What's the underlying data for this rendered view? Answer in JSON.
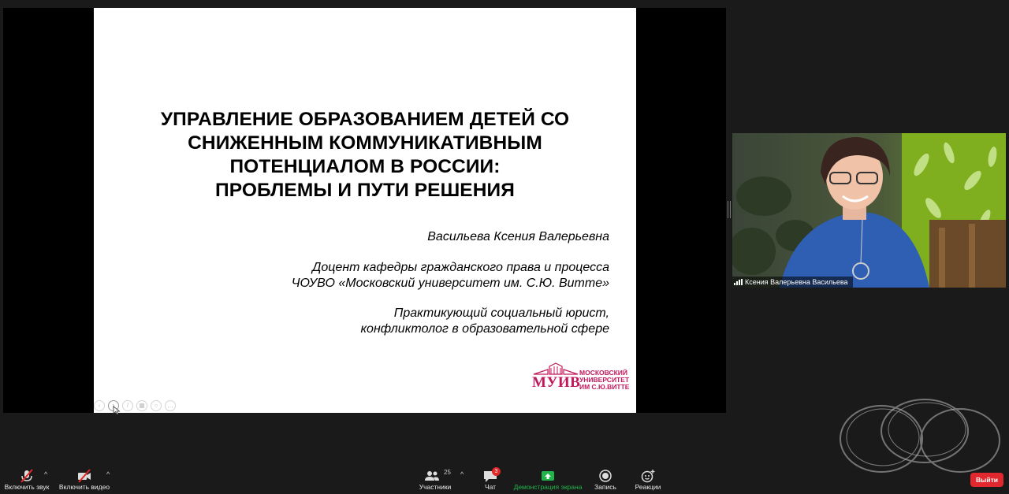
{
  "slide": {
    "title_lines": [
      "УПРАВЛЕНИЕ ОБРАЗОВАНИЕМ ДЕТЕЙ СО",
      "СНИЖЕННЫМ КОММУНИКАТИВНЫМ",
      "ПОТЕНЦИАЛОМ В РОССИИ:",
      "ПРОБЛЕМЫ И ПУТИ РЕШЕНИЯ"
    ],
    "author": "Васильева Ксения Валерьевна",
    "position_lines": [
      "Доцент кафедры гражданского права и процесса",
      "ЧОУВО «Московский университет им. С.Ю. Витте»"
    ],
    "practice_lines": [
      "Практикующий социальный юрист,",
      "конфликтолог в образовательной сфере"
    ],
    "logo": {
      "abbr": "МУИВ",
      "lines": [
        "МОСКОВСКИЙ",
        "УНИВЕРСИТЕТ",
        "ИМ С.Ю.ВИТТЕ"
      ],
      "color": "#c2185b"
    },
    "controls": [
      "arrow-left-icon",
      "arrow-right-icon",
      "pen-icon",
      "grid-icon",
      "zoom-icon",
      "more-icon"
    ]
  },
  "video": {
    "participant_name": "Ксения Валерьевна Васильева"
  },
  "toolbar": {
    "mute_label": "Включить звук",
    "video_label": "Включить видео",
    "participants_label": "Участники",
    "participants_count": "25",
    "chat_label": "Чат",
    "chat_badge": "3",
    "share_label": "Демонстрация экрана",
    "record_label": "Запись",
    "reactions_label": "Реакции",
    "leave_label": "Выйти",
    "share_color": "#1fb54b",
    "leave_color": "#e0282e"
  }
}
